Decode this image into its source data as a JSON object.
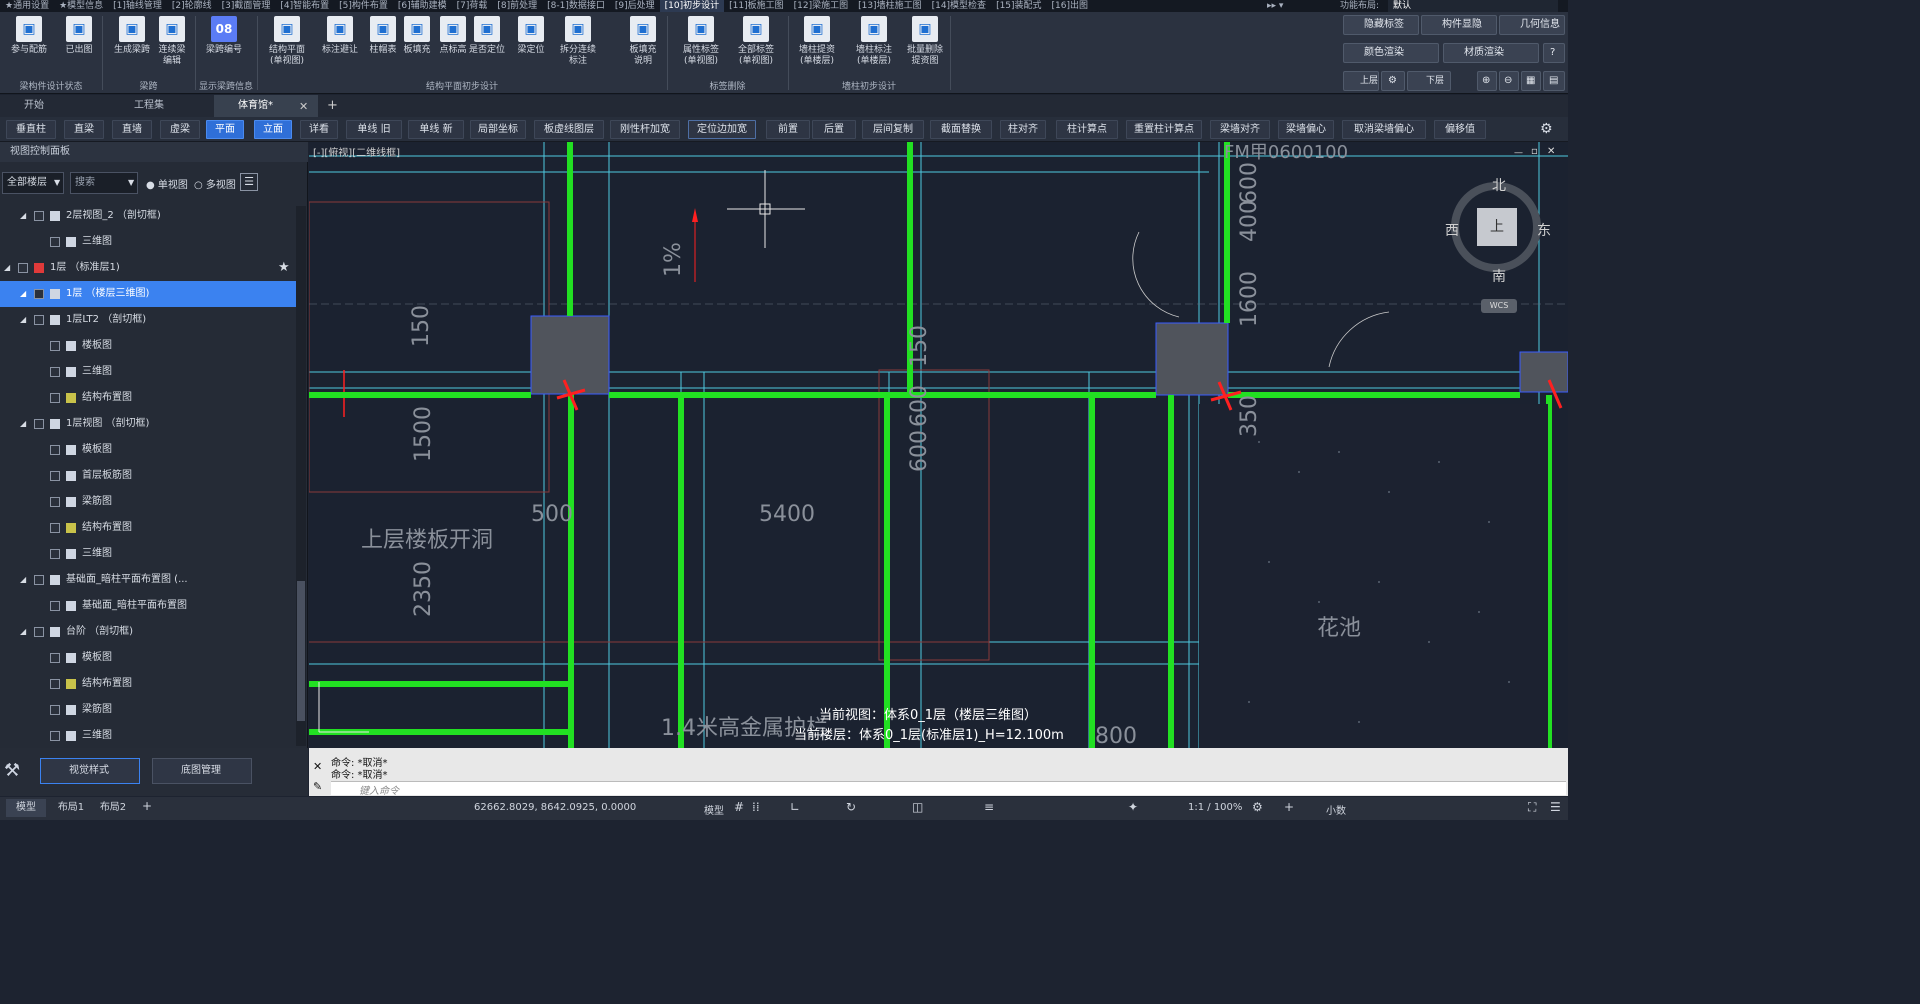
{
  "menubar": {
    "items": [
      "★通用设置",
      "★模型信息",
      "[1]轴线管理",
      "[2]轮廓线",
      "[3]截面管理",
      "[4]智能布置",
      "[5]构件布置",
      "[6]辅助建模",
      "[7]荷载",
      "[8]前处理",
      "[8-1]数据接口",
      "[9]后处理",
      "[10]初步设计",
      "[11]板施工图",
      "[12]梁施工图",
      "[13]墙柱施工图",
      "[14]模型检查",
      "[15]装配式",
      "[16]出图"
    ],
    "active_index": 12,
    "more": "▸▸ ▾",
    "layout_label": "功能布局:",
    "layout_value": "默认"
  },
  "ribbon": {
    "buttons": [
      {
        "label": "参与配筋",
        "icon": "participate-icon"
      },
      {
        "label": "已出图",
        "icon": "check-icon"
      },
      {
        "label": "生成梁跨",
        "icon": "span-icon"
      },
      {
        "label": "连续梁\n编辑",
        "icon": "edit-icon"
      },
      {
        "label": "梁跨编号",
        "icon": "number-icon",
        "badge": "08"
      },
      {
        "label": "结构平面\n(单视图)",
        "icon": "plan-icon"
      },
      {
        "label": "标注避让",
        "icon": "avoid-icon"
      },
      {
        "label": "柱帽表",
        "icon": "table-icon"
      },
      {
        "label": "板填充",
        "icon": "fill-icon"
      },
      {
        "label": "点标高",
        "icon": "elev-icon"
      },
      {
        "label": "是否定位",
        "icon": "locate-icon"
      },
      {
        "label": "梁定位",
        "icon": "beam-locate-icon"
      },
      {
        "label": "拆分连续标注",
        "icon": "split-icon"
      },
      {
        "label": "板填充\n说明",
        "icon": "grid-icon"
      },
      {
        "label": "属性标签\n(单视图)",
        "icon": "delete-tag-icon"
      },
      {
        "label": "全部标签\n(单视图)",
        "icon": "all-tag-icon"
      },
      {
        "label": "墙柱提资\n(单楼层)",
        "icon": "wall-col-icon"
      },
      {
        "label": "墙柱标注\n(单楼层)",
        "icon": "wall-col-dim-icon"
      },
      {
        "label": "批量删除\n提资图",
        "icon": "batch-delete-icon"
      }
    ],
    "groups": [
      "梁构件设计状态",
      "梁跨",
      "显示梁跨信息",
      "结构平面初步设计",
      "标签删除",
      "墙柱初步设计"
    ],
    "side": {
      "hide_tag": "隐藏标签",
      "component_show": "构件显隐",
      "geometry_info": "几何信息",
      "color_render": "颜色渲染",
      "material_render": "材质渲染",
      "up_floor": "上层",
      "down_floor": "下层"
    }
  },
  "tabs": [
    {
      "label": "开始"
    },
    {
      "label": "工程集"
    },
    {
      "label": "体育馆*"
    }
  ],
  "toolbar2": {
    "items": [
      "垂直柱",
      "直梁",
      "直墙",
      "虚梁",
      "平面",
      "立面",
      "详看",
      "单线 旧",
      "单线 新",
      "局部坐标",
      "板虚线图层",
      "刚性杆加宽",
      "定位边加宽",
      "前置",
      "后置",
      "层间复制",
      "截面替换",
      "柱对齐",
      "柱计算点",
      "重置柱计算点",
      "梁墙对齐",
      "梁墙偏心",
      "取消梁墙偏心",
      "偏移值"
    ],
    "on": [
      4,
      5
    ]
  },
  "left_panel": {
    "title": "视图控制面板",
    "floor_select": "全部楼层",
    "search_placeholder": "搜索",
    "single_view": "单视图",
    "multi_view": "多视图",
    "tree": [
      {
        "label": "2层视图_2 （剖切框)",
        "level": 1,
        "icon": "grid"
      },
      {
        "label": "三维图",
        "level": 2,
        "icon": "cube"
      },
      {
        "label": "1层 （标准层1)",
        "level": 0,
        "icon": "flag"
      },
      {
        "label": "1层 （楼层三维图)",
        "level": 1,
        "icon": "grid",
        "selected": true
      },
      {
        "label": "1层LT2 （剖切框)",
        "level": 1,
        "icon": "grid"
      },
      {
        "label": "楼板图",
        "level": 2,
        "icon": "grid"
      },
      {
        "label": "三维图",
        "level": 2,
        "icon": "cube"
      },
      {
        "label": "结构布置图",
        "level": 2,
        "icon": "yellow"
      },
      {
        "label": "1层视图 （剖切框)",
        "level": 1,
        "icon": "grid"
      },
      {
        "label": "模板图",
        "level": 2,
        "icon": "grid"
      },
      {
        "label": "首层板筋图",
        "level": 2,
        "icon": "grid"
      },
      {
        "label": "梁筋图",
        "level": 2,
        "icon": "grid"
      },
      {
        "label": "结构布置图",
        "level": 2,
        "icon": "yellow"
      },
      {
        "label": "三维图",
        "level": 2,
        "icon": "cube"
      },
      {
        "label": "基础面_暗柱平面布置图 (...",
        "level": 1,
        "icon": "grid"
      },
      {
        "label": "基础面_暗柱平面布置图",
        "level": 2,
        "icon": "grid"
      },
      {
        "label": "台阶 （剖切框)",
        "level": 1,
        "icon": "grid"
      },
      {
        "label": "模板图",
        "level": 2,
        "icon": "grid"
      },
      {
        "label": "结构布置图",
        "level": 2,
        "icon": "yellow"
      },
      {
        "label": "梁筋图",
        "level": 2,
        "icon": "grid"
      },
      {
        "label": "三维图",
        "level": 2,
        "icon": "cube"
      }
    ],
    "bottom": {
      "visual_style": "视觉样式",
      "base_map": "底图管理"
    }
  },
  "canvas": {
    "view_label": "[-][俯视][二维线框]",
    "compass": {
      "north": "北",
      "south": "南",
      "east": "东",
      "west": "西",
      "top": "上",
      "wcs": "WCS"
    },
    "dims": [
      "150",
      "1500",
      "2350",
      "500",
      "5400",
      "600",
      "600",
      "150",
      "400",
      "600",
      "1600",
      "350",
      "800",
      "1%",
      "FM甲0600100"
    ],
    "labels": {
      "opening": "上层楼板开洞",
      "pool": "花池",
      "rail": "1.4米高金属护栏"
    },
    "status": {
      "current_view": "当前视图：体系0_1层（楼层三维图）",
      "current_floor": "当前楼层：体系0_1层(标准层1)_H=12.100m"
    }
  },
  "command": {
    "line1": "命令: *取消*",
    "line2": "命令: *取消*",
    "placeholder": "键入命令"
  },
  "statusbar": {
    "tabs": [
      "模型",
      "布局1",
      "布局2"
    ],
    "coords": "62662.8029, 8642.0925, 0.0000",
    "mode": "模型",
    "scale": "1:1 / 100%",
    "decimal": "小数"
  },
  "colors": {
    "accent": "#3b82f0",
    "green": "#22e022",
    "cyan": "#4fc9e0",
    "red": "#ff2020"
  }
}
